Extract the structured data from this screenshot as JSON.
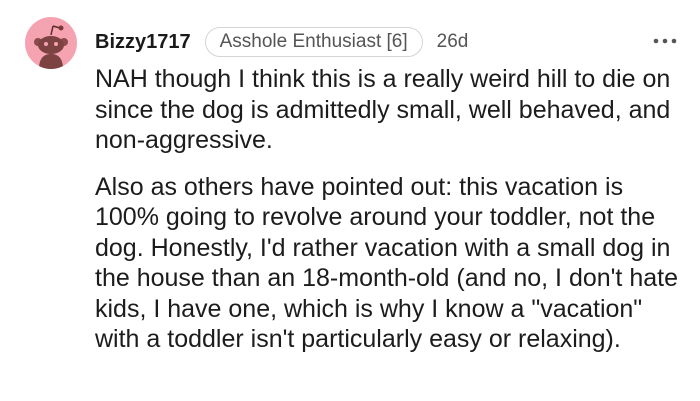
{
  "comment": {
    "username": "Bizzy1717",
    "flair": "Asshole Enthusiast [6]",
    "timestamp": "26d",
    "paragraphs": [
      "NAH though I think this is a really weird hill to die on since the dog is admittedly small, well behaved, and non-aggressive.",
      "Also as others have pointed out: this vacation is 100% going to revolve around your toddler, not the dog. Honestly, I'd rather vacation with a small dog in the house than an 18-month-old (and no, I don't hate kids, I have one, which is why I know a \"vacation\" with a toddler isn't particularly easy or relaxing)."
    ]
  },
  "icons": {
    "avatar": "snoo-avatar-icon",
    "more": "more-options-icon"
  },
  "colors": {
    "avatar_bg": "#f5a3b1",
    "text": "#1c1c1c",
    "meta": "#555555",
    "flair_border": "#d4d4d4"
  }
}
